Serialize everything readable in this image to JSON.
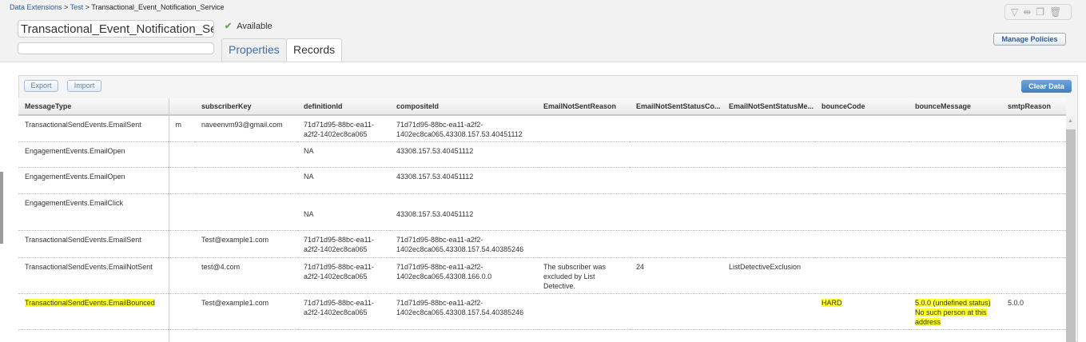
{
  "breadcrumb": [
    "Data Extensions",
    "Test",
    "Transactional_Event_Notification_Service"
  ],
  "breadcrumb_sep": ">",
  "name": "Transactional_Event_Notification_Ser",
  "description": "",
  "status": "Available",
  "tabs": [
    {
      "label": "Properties"
    },
    {
      "label": "Records"
    }
  ],
  "toolbar_icons": [
    "filter-icon",
    "columns-icon",
    "copy-icon",
    "trash-icon"
  ],
  "manage_policies": "Manage Policies",
  "export": "Export",
  "import": "Import",
  "clear_data": "Clear Data",
  "columns": [
    "MessageType",
    "",
    "subscriberKey",
    "definitionId",
    "compositeId",
    "EmailNotSentReason",
    "EmailNotSentStatusCo...",
    "EmailNotSentStatusMe...",
    "bounceCode",
    "bounceMessage",
    "smtpReason"
  ],
  "rows": [
    [
      "TransactionalSendEvents.EmailSent",
      "m",
      "naveenvm93@gmail.com",
      "71d71d95-88bc-ea11-a2f2-1402ec8ca065",
      "71d71d95-88bc-ea11-a2f2-1402ec8ca065.43308.157.53.40451112",
      "",
      "",
      "",
      "",
      "",
      ""
    ],
    [
      "EngagementEvents.EmailOpen",
      "",
      "",
      "NA",
      "43308.157.53.40451112",
      "",
      "",
      "",
      "",
      "",
      ""
    ],
    [
      "EngagementEvents.EmailOpen",
      "",
      "",
      "NA",
      "43308.157.53.40451112",
      "",
      "",
      "",
      "",
      "",
      ""
    ],
    [
      "EngagementEvents.EmailClick",
      "",
      "",
      "NA",
      "43308.157.53.40451112",
      "",
      "",
      "",
      "",
      "",
      ""
    ],
    [
      "TransactionalSendEvents.EmailSent",
      "",
      "Test@example1.com",
      "71d71d95-88bc-ea11-a2f2-1402ec8ca065",
      "71d71d95-88bc-ea11-a2f2-1402ec8ca065.43308.157.54.40385246",
      "",
      "",
      "",
      "",
      "",
      ""
    ],
    [
      "TransactionalSendEvents.EmailNotSent",
      "",
      "test@4.com",
      "71d71d95-88bc-ea11-a2f2-1402ec8ca065",
      "71d71d95-88bc-ea11-a2f2-1402ec8ca065.43308.166.0.0",
      "The subscriber was excluded by List Detective.",
      "24",
      "ListDetectiveExclusion",
      "",
      "",
      ""
    ],
    [
      "TransactionalSendEvents.EmailBounced",
      "",
      "Test@example1.com",
      "71d71d95-88bc-ea11-a2f2-1402ec8ca065",
      "71d71d95-88bc-ea11-a2f2-1402ec8ca065.43308.157.54.40385246",
      "",
      "",
      "",
      "HARD",
      "5.0.0 (undefined status) No such person at this address",
      "5.0.0"
    ]
  ]
}
